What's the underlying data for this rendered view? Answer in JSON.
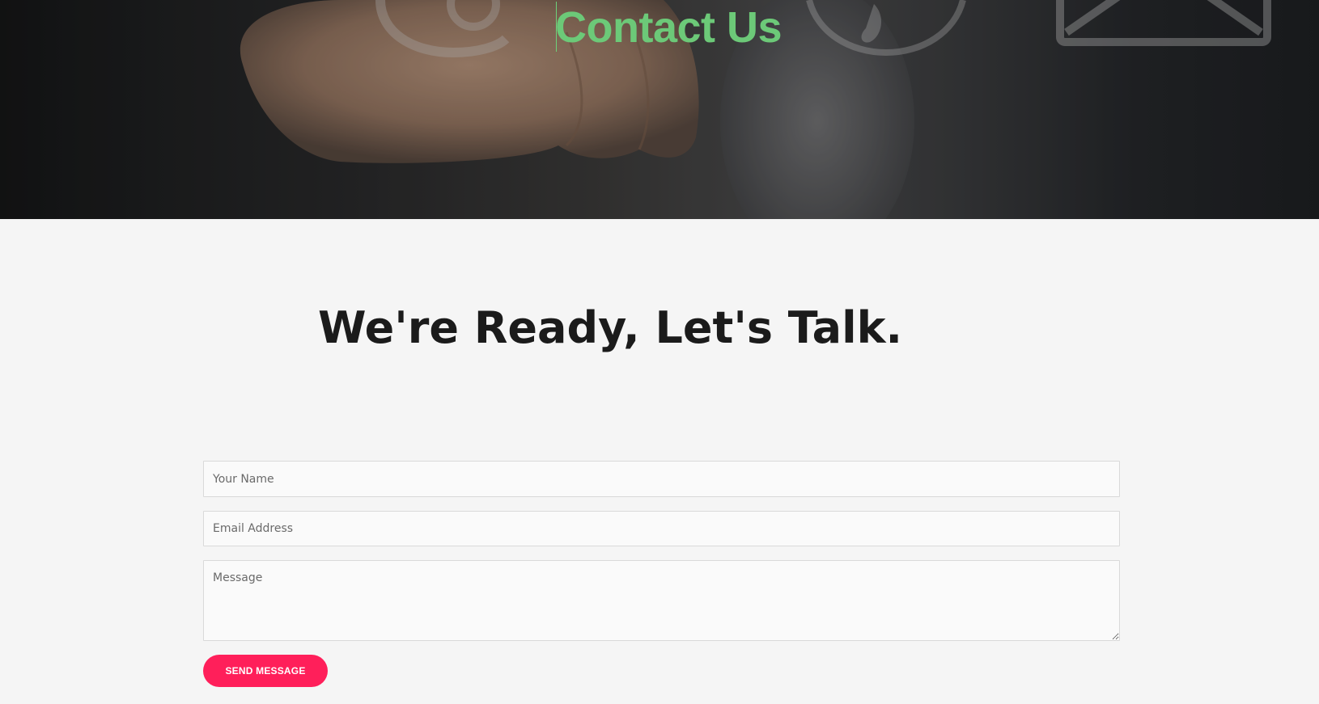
{
  "hero": {
    "title": "Contact Us",
    "title_color": "#6cc978"
  },
  "main": {
    "headline": "We're Ready, Let's Talk."
  },
  "form": {
    "name_placeholder": "Your Name",
    "email_placeholder": "Email Address",
    "message_placeholder": "Message",
    "send_label": "SEND MESSAGE",
    "button_color": "#ff1f5a"
  },
  "icons": [
    "at-sign-icon",
    "phone-icon",
    "envelope-icon",
    "hand-image"
  ]
}
